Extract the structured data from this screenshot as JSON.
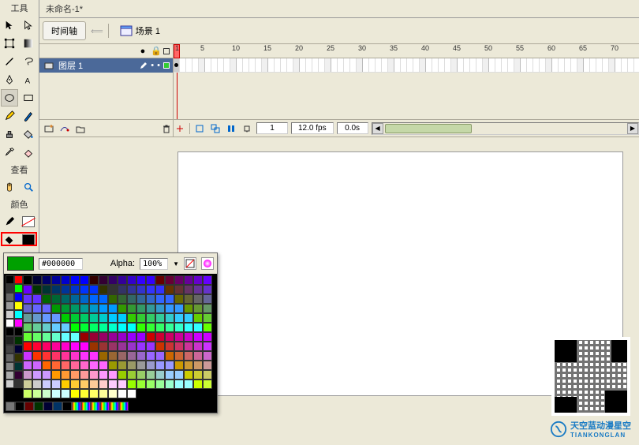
{
  "panels": {
    "tools_title": "工具",
    "view_title": "查看",
    "color_title": "颜色"
  },
  "document": {
    "tab_title": "未命名-1*",
    "timeline_btn": "时间轴",
    "scene_label": "场景 1"
  },
  "timeline": {
    "layer_name": "图层 1",
    "ruler_marks": [
      "1",
      "5",
      "10",
      "15",
      "20",
      "25",
      "30",
      "35",
      "40",
      "45",
      "50",
      "55",
      "60",
      "65",
      "70"
    ],
    "current_frame": "1",
    "fps": "12.0 fps",
    "elapsed": "0.0s"
  },
  "color_popup": {
    "hex": "#000000",
    "alpha_label": "Alpha:",
    "alpha_value": "100%"
  },
  "watermark": {
    "brand_cn": "天空蓝",
    "brand_sub": "动漫星空",
    "brand_pinyin": "TIANKONGLAN"
  },
  "icons": {
    "eye": "👁",
    "lock": "🔒"
  }
}
